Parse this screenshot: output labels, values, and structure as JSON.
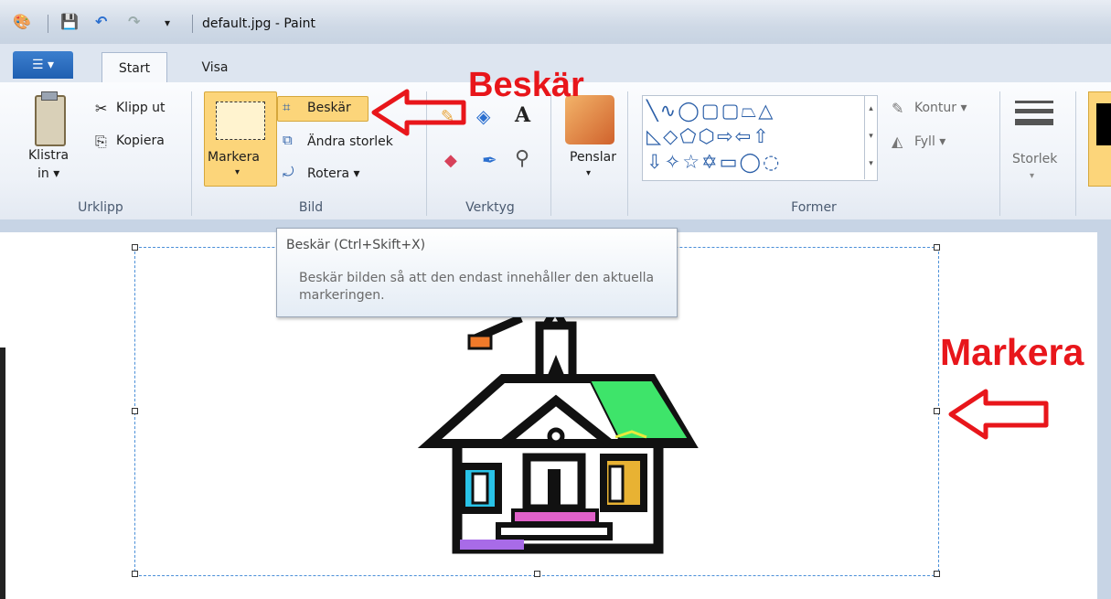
{
  "window": {
    "title": "default.jpg - Paint"
  },
  "tabs": [
    {
      "label": "Start"
    },
    {
      "label": "Visa"
    }
  ],
  "ribbon": {
    "urklipp": {
      "label": "Urklipp",
      "paste": "Klistra",
      "paste2": "in ▾",
      "cut": "Klipp ut",
      "copy": "Kopiera"
    },
    "bild": {
      "label": "Bild",
      "select": "Markera",
      "crop": "Beskär",
      "resize": "Ändra storlek",
      "rotate": "Rotera ▾"
    },
    "verktyg": {
      "label": "Verktyg"
    },
    "penslar": {
      "label": "Penslar"
    },
    "former": {
      "label": "Former",
      "outline": "Kontur ▾",
      "fill": "Fyll ▾"
    },
    "storlek": {
      "label": "Storlek"
    }
  },
  "tooltip": {
    "title": "Beskär (Ctrl+Skift+X)",
    "body": "Beskär bilden så att den endast innehåller den aktuella markeringen."
  },
  "annotations": {
    "crop": "Beskär",
    "select": "Markera"
  },
  "colors": {
    "accent": "#e8161b",
    "selected_button": "#fcd57a",
    "file_button": "#2c6dbf"
  }
}
